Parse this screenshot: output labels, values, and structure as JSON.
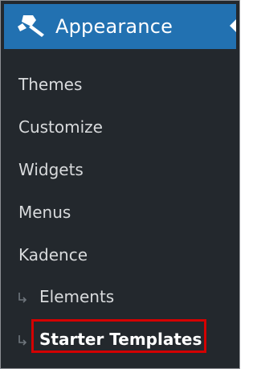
{
  "header": {
    "icon": "paintbrush-icon",
    "title": "Appearance",
    "accent": "#2271b1"
  },
  "submenu": {
    "items": [
      {
        "label": "Themes"
      },
      {
        "label": "Customize"
      },
      {
        "label": "Widgets"
      },
      {
        "label": "Menus"
      },
      {
        "label": "Kadence"
      },
      {
        "label": "Elements",
        "icon": "sub-arrow-icon"
      },
      {
        "label": "Starter Templates",
        "icon": "sub-arrow-icon",
        "highlighted": true
      }
    ]
  },
  "colors": {
    "sidebar_bg": "#23282d",
    "text": "#d8dadc",
    "highlight_border": "#d40000"
  }
}
